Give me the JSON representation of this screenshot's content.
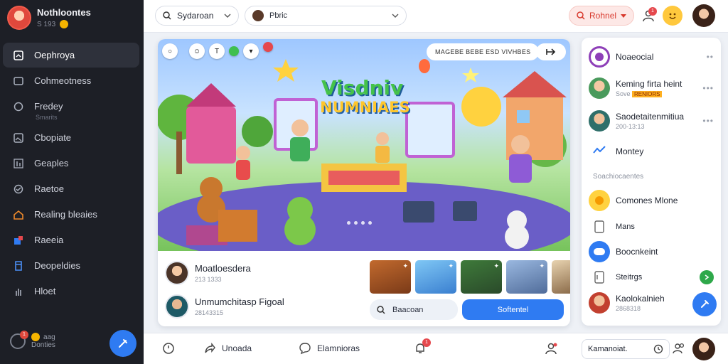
{
  "brand": {
    "name": "Nothloontes",
    "sub": "S 193"
  },
  "nav": {
    "items": [
      {
        "label": "Oephroya",
        "icon": "square-icon",
        "active": true
      },
      {
        "label": "Cohmeotness",
        "icon": "window-icon"
      },
      {
        "label": "Fredey",
        "icon": "circle-icon",
        "sub": "Smarits"
      },
      {
        "label": "Cbopiate",
        "icon": "image-icon"
      },
      {
        "label": "Geaples",
        "icon": "bar-chart-icon"
      },
      {
        "label": "Raetoe",
        "icon": "check-circle-icon"
      },
      {
        "label": "Realing bleaies",
        "icon": "home-icon"
      },
      {
        "label": "Raeeia",
        "icon": "puzzle-icon"
      },
      {
        "label": "Deopeldies",
        "icon": "document-icon"
      },
      {
        "label": "Hloet",
        "icon": "hand-icon"
      }
    ],
    "footer_text": "Donties",
    "footer_count": "aag",
    "footer_badge": "1"
  },
  "topbar": {
    "search_label": "Sydaroan",
    "account_label": "Pbric",
    "action_label": "Rohnel",
    "notif_badge": "1"
  },
  "hero": {
    "caption": "MAGEBE BEBE ESD VIVHBES",
    "title_line1": "Visdniv",
    "title_line2": "NUMNIAES"
  },
  "posts": [
    {
      "name": "Moatloesdera",
      "meta": "213 1333"
    },
    {
      "name": "Unmumchitasp Figoal",
      "meta": "28143315"
    }
  ],
  "mini_search": {
    "placeholder": "Baacoan"
  },
  "primary_button": {
    "label": "Softentel"
  },
  "right_panel": {
    "items": [
      {
        "name": "Noaeocial",
        "meta": "",
        "kind": "avatar",
        "color": "#8e3fb8"
      },
      {
        "name": "Keming firta heint",
        "meta": "Sove",
        "tag": "RENIORS",
        "kind": "avatar",
        "color": "#4a9a5c"
      },
      {
        "name": "Saodetaitenmitiua",
        "meta": "200-13:13",
        "kind": "avatar",
        "color": "#2f6f6a"
      },
      {
        "name": "Montey",
        "meta": "",
        "kind": "icon",
        "icon": "chart-icon"
      }
    ],
    "section_title": "Soachiocaentes",
    "items2": [
      {
        "name": "Comones Mlone",
        "meta": "",
        "kind": "icon",
        "icon": "sun-icon"
      },
      {
        "name": "Mans",
        "meta": "",
        "kind": "icon",
        "icon": "bookmark-icon"
      },
      {
        "name": "Boocnkeint",
        "meta": "",
        "kind": "icon",
        "icon": "chat-icon"
      },
      {
        "name": "Steitrgs",
        "meta": "",
        "kind": "icon",
        "icon": "document-icon"
      },
      {
        "name": "Kaolokalnieh",
        "meta": "2868318",
        "kind": "avatar",
        "color": "#c2402f"
      }
    ]
  },
  "bottombar": {
    "item1": "Unoada",
    "item2": "Elamnioras",
    "pill_label": "Kamanoiat.",
    "notif_badge": "1"
  },
  "colors": {
    "accent": "#2f7bf2",
    "sidebar": "#1d1f26",
    "danger": "#e5484d",
    "success": "#2ea84a"
  }
}
